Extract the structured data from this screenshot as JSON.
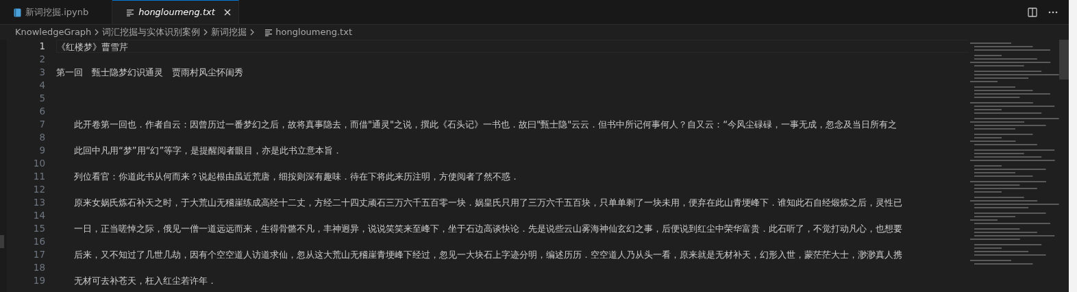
{
  "tabs": [
    {
      "label": "新词挖掘.ipynb",
      "kind": "notebook",
      "selected": false,
      "preview": false
    },
    {
      "label": "hongloumeng.txt",
      "kind": "text",
      "selected": true,
      "preview": true
    }
  ],
  "breadcrumbs": [
    {
      "label": "KnowledgeGraph",
      "kind": "folder"
    },
    {
      "label": "词汇挖掘与实体识别案例",
      "kind": "folder"
    },
    {
      "label": "新词挖掘",
      "kind": "folder"
    },
    {
      "label": "hongloumeng.txt",
      "kind": "file"
    }
  ],
  "editor": {
    "lines": [
      {
        "number": "1",
        "current": true,
        "text": "《红楼梦》曹雪芹"
      },
      {
        "number": "2",
        "current": false
      },
      {
        "number": "3",
        "current": false,
        "text": "第一回　甄士隐梦幻识通灵　贾雨村风尘怀闺秀"
      },
      {
        "number": "4",
        "current": false
      },
      {
        "number": "5",
        "current": false
      },
      {
        "number": "6",
        "current": false
      },
      {
        "number": "7",
        "current": false,
        "text": "　　此开卷第一回也．作者自云：因曾历过一番梦幻之后，故将真事隐去，而借\"通灵\"之说，撰此《石头记》一书也．故曰\"甄士隐\"云云．但书中所记何事何人？自又云：“今风尘碌碌，一事无成，忽念及当日所有之"
      },
      {
        "number": "8",
        "current": false
      },
      {
        "number": "9",
        "current": false,
        "text": "　　此回中凡用“梦”用“幻”等字，是提醒阅者眼目，亦是此书立意本旨．"
      },
      {
        "number": "10",
        "current": false
      },
      {
        "number": "11",
        "current": false,
        "text": "　　列位看官：你道此书从何而来？说起根由虽近荒唐，细按则深有趣味．待在下将此来历注明，方使阅者了然不惑．"
      },
      {
        "number": "12",
        "current": false
      },
      {
        "number": "13",
        "current": false,
        "text": "　　原来女娲氏炼石补天之时，于大荒山无稽崖练成高经十二丈，方经二十四丈顽石三万六千五百零一块．娲皇氏只用了三万六千五百块，只单单剩了一块未用，便弃在此山青埂峰下．谁知此石自经煅炼之后，灵性已"
      },
      {
        "number": "14",
        "current": false
      },
      {
        "number": "15",
        "current": false,
        "text": "　　一日，正当嗟悼之际，俄见一僧一道远远而来，生得骨骼不凡，丰神迥异，说说笑笑来至峰下，坐于石边高谈快论．先是说些云山雾海神仙玄幻之事，后便说到红尘中荣华富贵．此石听了，不觉打动凡心，也想要"
      },
      {
        "number": "16",
        "current": false
      },
      {
        "number": "17",
        "current": false,
        "text": "　　后来，又不知过了几世几劫，因有个空空道人访道求仙，忽从这大荒山无稽崖青埂峰下经过，忽见一大块石上字迹分明，编述历历．空空道人乃从头一看，原来就是无材补天，幻形入世，蒙茫茫大士，渺渺真人携"
      },
      {
        "number": "18",
        "current": false
      },
      {
        "number": "19",
        "current": false,
        "text": "　　无材可去补苍天，枉入红尘若许年．"
      }
    ]
  }
}
